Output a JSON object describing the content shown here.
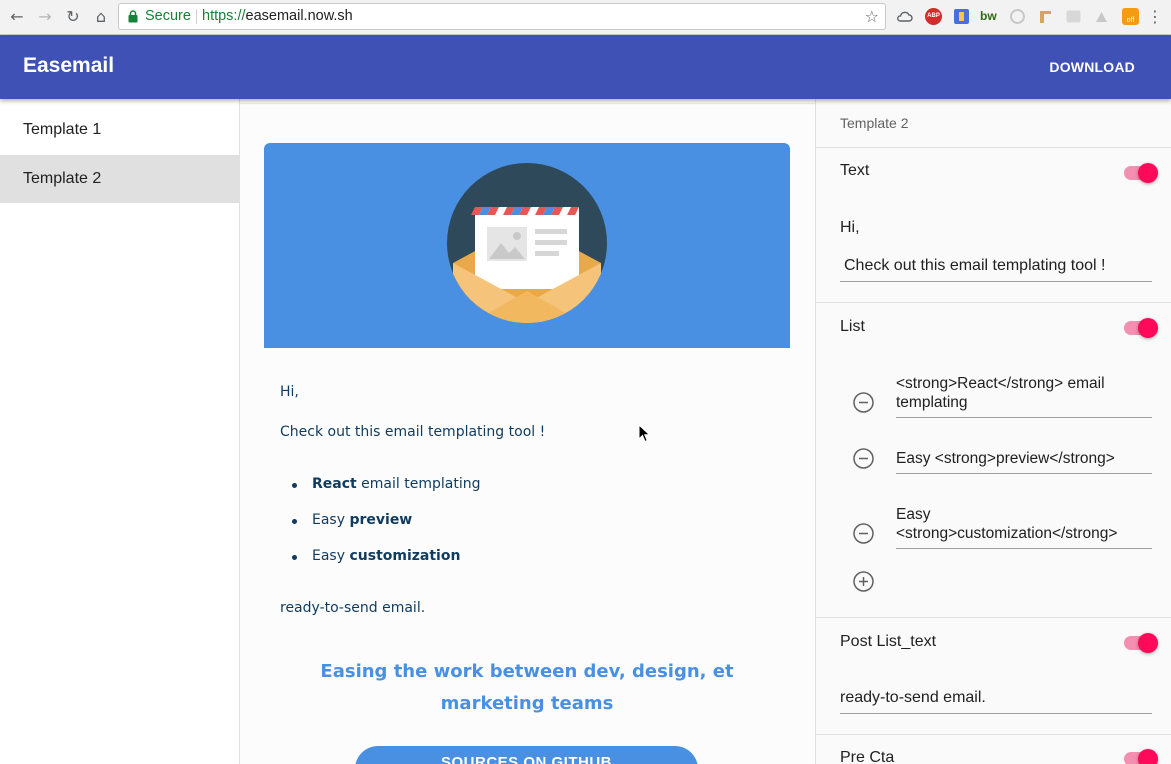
{
  "browser": {
    "secure_label": "Secure",
    "url_scheme": "https://",
    "url_host": "easemail.now.sh",
    "ext_abp": "ABP",
    "ext_bw": "bw",
    "ext_off": "off"
  },
  "appbar": {
    "title": "Easemail",
    "download_label": "DOWNLOAD",
    "color": "#3f51b5"
  },
  "sidebar": {
    "items": [
      {
        "label": "Template 1"
      },
      {
        "label": "Template 2"
      }
    ],
    "selected_index": 1
  },
  "preview": {
    "greeting": "Hi,",
    "text": "Check out this email templating tool !",
    "list": [
      {
        "bold": "React",
        "rest": " email templating",
        "order": "bold-first"
      },
      {
        "pre": "Easy ",
        "bold": "preview"
      },
      {
        "pre": "Easy ",
        "bold": "customization"
      }
    ],
    "post_list_text": "ready-to-send email.",
    "headline": "Easing the work between dev, design, et marketing teams",
    "cta_label": "SOURCES ON GITHUB",
    "hero_color": "#4a90e2"
  },
  "panel": {
    "template_title": "Template 2",
    "sections": {
      "text": {
        "label": "Text",
        "enabled": true,
        "greeting": "Hi,",
        "value": "Check out this email templating tool !"
      },
      "list": {
        "label": "List",
        "enabled": true,
        "items": [
          "<strong>React</strong> email templating",
          "Easy <strong>preview</strong>",
          "Easy <strong>customization</strong>"
        ]
      },
      "post_list": {
        "label": "Post List_text",
        "enabled": true,
        "value": "ready-to-send email."
      },
      "pre_cta": {
        "label": "Pre Cta",
        "enabled": true
      }
    },
    "toggle_color": "#ff0a5a"
  }
}
